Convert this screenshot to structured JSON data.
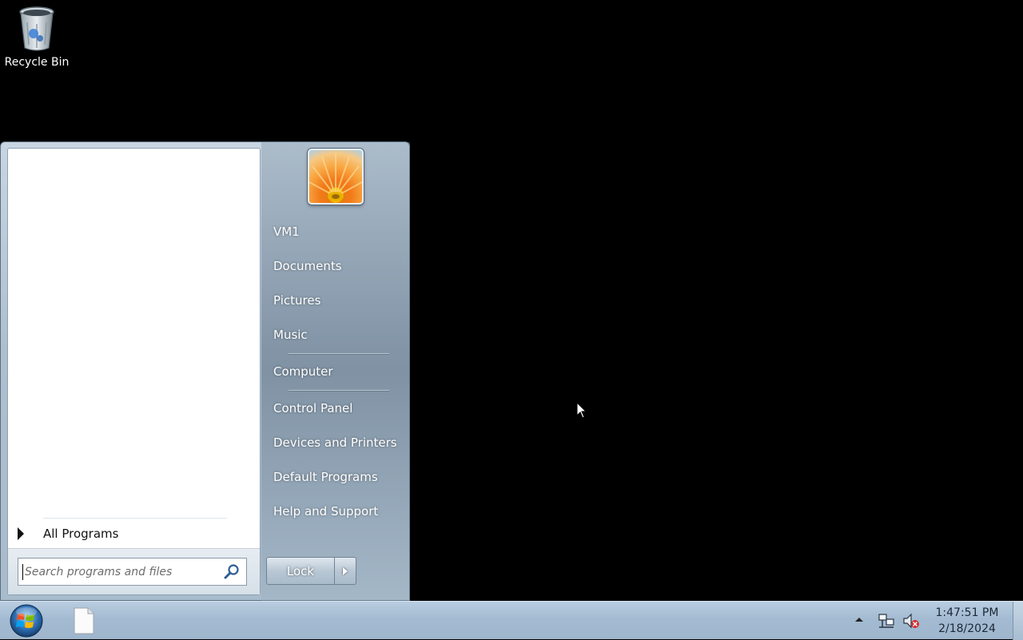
{
  "desktop": {
    "icons": [
      {
        "label": "Recycle Bin",
        "icon": "recycle-bin-icon"
      }
    ]
  },
  "start_menu": {
    "all_programs_label": "All Programs",
    "search": {
      "placeholder": "Search programs and files",
      "value": ""
    },
    "user_picture": "flower-user-picture",
    "right_items": [
      {
        "label": "VM1"
      },
      {
        "label": "Documents"
      },
      {
        "label": "Pictures"
      },
      {
        "label": "Music"
      },
      {
        "label": "Computer"
      },
      {
        "label": "Control Panel"
      },
      {
        "label": "Devices and Printers"
      },
      {
        "label": "Default Programs"
      },
      {
        "label": "Help and Support"
      }
    ],
    "lock_label": "Lock"
  },
  "taskbar": {
    "pinned": [
      {
        "icon": "blank-document-icon"
      }
    ],
    "tray_icons": [
      "show-hidden-icons-arrow",
      "network-icon",
      "volume-muted-icon"
    ],
    "clock": {
      "time": "1:47:51 PM",
      "date": "2/18/2024"
    }
  },
  "colors": {
    "desktop_background": "#000000",
    "taskbar": "#a3bbd2",
    "start_menu_right_pane": "#aebfce"
  }
}
